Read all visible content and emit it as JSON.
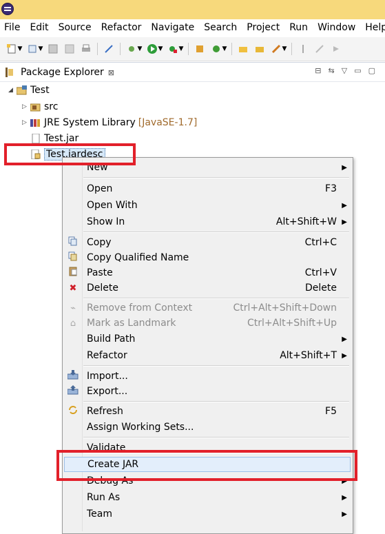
{
  "menubar": [
    "File",
    "Edit",
    "Source",
    "Refactor",
    "Navigate",
    "Search",
    "Project",
    "Run",
    "Window",
    "Help"
  ],
  "view": {
    "title": "Package Explorer",
    "close": "⊠"
  },
  "tree": {
    "project": "Test",
    "src": "src",
    "jre": "JRE System Library",
    "jre_version": "[JavaSE-1.7]",
    "jar": "Test.jar",
    "jardesc": "Test.jardesc"
  },
  "context_menu": {
    "new": "New",
    "open": "Open",
    "open_sc": "F3",
    "open_with": "Open With",
    "show_in": "Show In",
    "show_in_sc": "Alt+Shift+W",
    "copy": "Copy",
    "copy_sc": "Ctrl+C",
    "copy_qualified": "Copy Qualified Name",
    "paste": "Paste",
    "paste_sc": "Ctrl+V",
    "delete": "Delete",
    "delete_sc": "Delete",
    "remove_ctx": "Remove from Context",
    "remove_ctx_sc": "Ctrl+Alt+Shift+Down",
    "landmark": "Mark as Landmark",
    "landmark_sc": "Ctrl+Alt+Shift+Up",
    "build_path": "Build Path",
    "refactor": "Refactor",
    "refactor_sc": "Alt+Shift+T",
    "import": "Import...",
    "export": "Export...",
    "refresh": "Refresh",
    "refresh_sc": "F5",
    "working_sets": "Assign Working Sets...",
    "validate": "Validate",
    "create_jar": "Create JAR",
    "debug_as": "Debug As",
    "run_as": "Run As",
    "team": "Team"
  },
  "colors": {
    "title_bar": "#f7d97c",
    "highlight_box": "#e2202a",
    "selection": "#d6e8f8"
  }
}
